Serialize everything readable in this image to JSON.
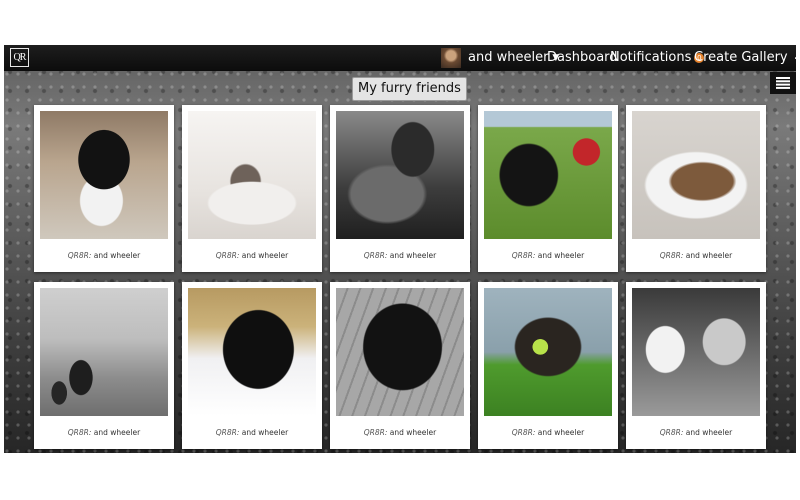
{
  "header": {
    "logo_text": "QR",
    "user_name": "and wheeler",
    "dashboard_label": "Dashboard",
    "notifications_label": "Notifications",
    "notifications_count": "0",
    "create_gallery_label": "Create Gallery",
    "create_gallery_icon": "plus-icon",
    "user_menu_icon": "chevron-down-icon",
    "menu_icon": "hamburger-menu-icon"
  },
  "gallery": {
    "title": "My furry friends",
    "cards": [
      {
        "owner": "QR8R:",
        "author": "and wheeler"
      },
      {
        "owner": "QR8R:",
        "author": "and wheeler"
      },
      {
        "owner": "QR8R:",
        "author": "and wheeler"
      },
      {
        "owner": "QR8R:",
        "author": "and wheeler"
      },
      {
        "owner": "QR8R:",
        "author": "and wheeler"
      },
      {
        "owner": "QR8R:",
        "author": "and wheeler"
      },
      {
        "owner": "QR8R:",
        "author": "and wheeler"
      },
      {
        "owner": "QR8R:",
        "author": "and wheeler"
      },
      {
        "owner": "QR8R:",
        "author": "and wheeler"
      },
      {
        "owner": "QR8R:",
        "author": "and wheeler"
      }
    ]
  },
  "colors": {
    "topbar": "#0c0c0c",
    "badge": "#e5822c",
    "card": "#ffffff"
  }
}
